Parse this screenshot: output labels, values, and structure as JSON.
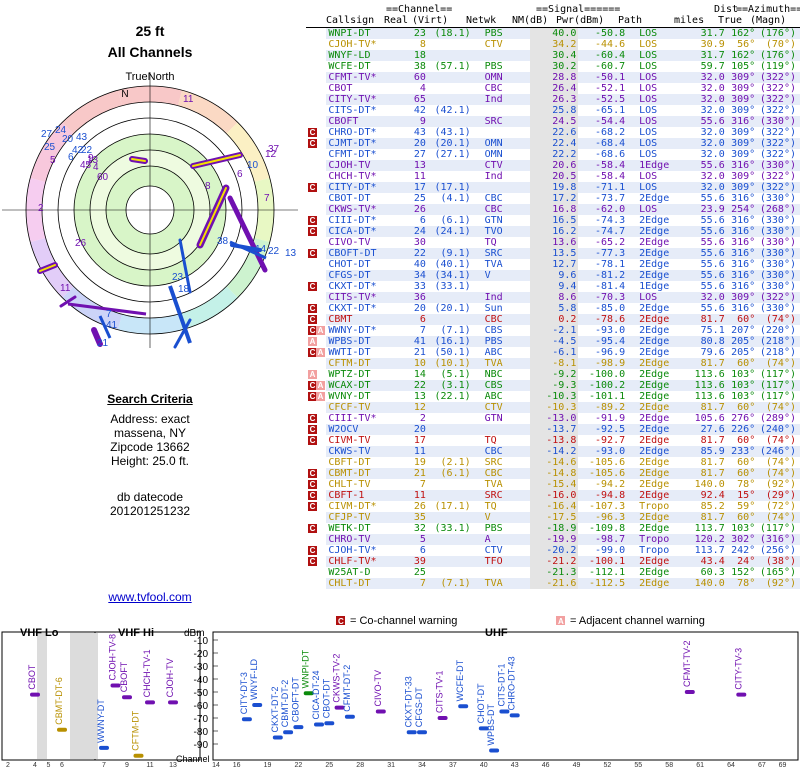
{
  "page": {
    "title": "25 ft",
    "subtitle": "All Channels"
  },
  "polar": {
    "north_label": "TrueNorth",
    "n_letter": "N"
  },
  "criteria": {
    "header": "Search Criteria",
    "address": "Address: exact",
    "city": "massena, NY",
    "zip": "Zipcode 13662",
    "height": "Height: 25.0 ft.",
    "db_label": "db datecode",
    "db_value": "201201251232"
  },
  "link": "www.tvfool.com",
  "table_header": {
    "group_channel": "==Channel==",
    "group_signal": "==Signal======",
    "group_dist": "Dist",
    "group_azimuth": "==Azimuth==",
    "callsign": "Callsign",
    "real": "Real",
    "virt": "(Virt)",
    "netwk": "Netwk",
    "nm": "NM(dB)",
    "pwr": "Pwr(dBm)",
    "path": "Path",
    "miles": "miles",
    "true": "True",
    "magn": "(Magn)"
  },
  "colors": {
    "green": "#0a8a0a",
    "blue": "#1a4fd0",
    "red": "#c01010",
    "yellow": "#b89000",
    "purple": "#7010b0",
    "pink": "#c040c0",
    "gray_bg": "#e4e4e4",
    "blue_bg": "#e6ecf8"
  },
  "stations": [
    {
      "cs": "WNPI-DT",
      "real": "23",
      "virt": "(18.1)",
      "net": "PBS",
      "nm": "40.0",
      "pwr": "-50.8",
      "path": "LOS",
      "miles": "31.7",
      "az": "162°",
      "mag": "(176°)",
      "c": "green",
      "warn": ""
    },
    {
      "cs": "CJOH-TV*",
      "real": "8",
      "virt": "",
      "net": "CTV",
      "nm": "34.2",
      "pwr": "-44.6",
      "path": "LOS",
      "miles": "30.9",
      "az": "56°",
      "mag": "(70°)",
      "c": "yellow",
      "warn": ""
    },
    {
      "cs": "WNYF-LD",
      "real": "18",
      "virt": "",
      "net": "",
      "nm": "30.4",
      "pwr": "-60.4",
      "path": "LOS",
      "miles": "31.7",
      "az": "162°",
      "mag": "(176°)",
      "c": "green",
      "warn": ""
    },
    {
      "cs": "WCFE-DT",
      "real": "38",
      "virt": "(57.1)",
      "net": "PBS",
      "nm": "30.2",
      "pwr": "-60.7",
      "path": "LOS",
      "miles": "59.7",
      "az": "105°",
      "mag": "(119°)",
      "c": "green",
      "warn": ""
    },
    {
      "cs": "CFMT-TV*",
      "real": "60",
      "virt": "",
      "net": "OMN",
      "nm": "28.8",
      "pwr": "-50.1",
      "path": "LOS",
      "miles": "32.0",
      "az": "309°",
      "mag": "(322°)",
      "c": "purple",
      "warn": ""
    },
    {
      "cs": "CBOT",
      "real": "4",
      "virt": "",
      "net": "CBC",
      "nm": "26.4",
      "pwr": "-52.1",
      "path": "LOS",
      "miles": "32.0",
      "az": "309°",
      "mag": "(322°)",
      "c": "purple",
      "warn": ""
    },
    {
      "cs": "CITY-TV*",
      "real": "65",
      "virt": "",
      "net": "Ind",
      "nm": "26.3",
      "pwr": "-52.5",
      "path": "LOS",
      "miles": "32.0",
      "az": "309°",
      "mag": "(322°)",
      "c": "purple",
      "warn": ""
    },
    {
      "cs": "CITS-DT*",
      "real": "42",
      "virt": "(42.1)",
      "net": "",
      "nm": "25.8",
      "pwr": "-65.1",
      "path": "LOS",
      "miles": "32.0",
      "az": "309°",
      "mag": "(322°)",
      "c": "blue",
      "warn": ""
    },
    {
      "cs": "CBOFT",
      "real": "9",
      "virt": "",
      "net": "SRC",
      "nm": "24.5",
      "pwr": "-54.4",
      "path": "LOS",
      "miles": "55.6",
      "az": "316°",
      "mag": "(330°)",
      "c": "purple",
      "warn": ""
    },
    {
      "cs": "CHRO-DT*",
      "real": "43",
      "virt": "(43.1)",
      "net": "",
      "nm": "22.6",
      "pwr": "-68.2",
      "path": "LOS",
      "miles": "32.0",
      "az": "309°",
      "mag": "(322°)",
      "c": "blue",
      "warn": "C"
    },
    {
      "cs": "CJMT-DT*",
      "real": "20",
      "virt": "(20.1)",
      "net": "OMN",
      "nm": "22.4",
      "pwr": "-68.4",
      "path": "LOS",
      "miles": "32.0",
      "az": "309°",
      "mag": "(322°)",
      "c": "blue",
      "warn": "C"
    },
    {
      "cs": "CFMT-DT*",
      "real": "27",
      "virt": "(27.1)",
      "net": "OMN",
      "nm": "22.2",
      "pwr": "-68.6",
      "path": "LOS",
      "miles": "32.0",
      "az": "309°",
      "mag": "(322°)",
      "c": "blue",
      "warn": ""
    },
    {
      "cs": "CJOH-TV",
      "real": "13",
      "virt": "",
      "net": "CTV",
      "nm": "20.6",
      "pwr": "-58.4",
      "path": "1Edge",
      "miles": "55.6",
      "az": "316°",
      "mag": "(330°)",
      "c": "purple",
      "warn": ""
    },
    {
      "cs": "CHCH-TV*",
      "real": "11",
      "virt": "",
      "net": "Ind",
      "nm": "20.5",
      "pwr": "-58.4",
      "path": "LOS",
      "miles": "32.0",
      "az": "309°",
      "mag": "(322°)",
      "c": "purple",
      "warn": ""
    },
    {
      "cs": "CITY-DT*",
      "real": "17",
      "virt": "(17.1)",
      "net": "",
      "nm": "19.8",
      "pwr": "-71.1",
      "path": "LOS",
      "miles": "32.0",
      "az": "309°",
      "mag": "(322°)",
      "c": "blue",
      "warn": "C"
    },
    {
      "cs": "CBOT-DT",
      "real": "25",
      "virt": "(4.1)",
      "net": "CBC",
      "nm": "17.2",
      "pwr": "-73.7",
      "path": "2Edge",
      "miles": "55.6",
      "az": "316°",
      "mag": "(330°)",
      "c": "blue",
      "warn": ""
    },
    {
      "cs": "CKWS-TV*",
      "real": "26",
      "virt": "",
      "net": "CBC",
      "nm": "16.8",
      "pwr": "-62.0",
      "path": "LOS",
      "miles": "23.9",
      "az": "254°",
      "mag": "(268°)",
      "c": "purple",
      "warn": ""
    },
    {
      "cs": "CIII-DT*",
      "real": "6",
      "virt": "(6.1)",
      "net": "GTN",
      "nm": "16.5",
      "pwr": "-74.3",
      "path": "2Edge",
      "miles": "55.6",
      "az": "316°",
      "mag": "(330°)",
      "c": "blue",
      "warn": "C"
    },
    {
      "cs": "CICA-DT*",
      "real": "24",
      "virt": "(24.1)",
      "net": "TVO",
      "nm": "16.2",
      "pwr": "-74.7",
      "path": "2Edge",
      "miles": "55.6",
      "az": "316°",
      "mag": "(330°)",
      "c": "blue",
      "warn": "C"
    },
    {
      "cs": "CIVO-TV",
      "real": "30",
      "virt": "",
      "net": "TQ",
      "nm": "13.6",
      "pwr": "-65.2",
      "path": "2Edge",
      "miles": "55.6",
      "az": "316°",
      "mag": "(330°)",
      "c": "purple",
      "warn": ""
    },
    {
      "cs": "CBOFT-DT",
      "real": "22",
      "virt": "(9.1)",
      "net": "SRC",
      "nm": "13.5",
      "pwr": "-77.3",
      "path": "2Edge",
      "miles": "55.6",
      "az": "316°",
      "mag": "(330°)",
      "c": "blue",
      "warn": "C"
    },
    {
      "cs": "CHOT-DT",
      "real": "40",
      "virt": "(40.1)",
      "net": "TVA",
      "nm": "12.7",
      "pwr": "-78.1",
      "path": "2Edge",
      "miles": "55.6",
      "az": "316°",
      "mag": "(330°)",
      "c": "blue",
      "warn": ""
    },
    {
      "cs": "CFGS-DT",
      "real": "34",
      "virt": "(34.1)",
      "net": "V",
      "nm": "9.6",
      "pwr": "-81.2",
      "path": "2Edge",
      "miles": "55.6",
      "az": "316°",
      "mag": "(330°)",
      "c": "blue",
      "warn": ""
    },
    {
      "cs": "CKXT-DT*",
      "real": "33",
      "virt": "(33.1)",
      "net": "",
      "nm": "9.4",
      "pwr": "-81.4",
      "path": "1Edge",
      "miles": "55.6",
      "az": "316°",
      "mag": "(330°)",
      "c": "blue",
      "warn": "C"
    },
    {
      "cs": "CITS-TV*",
      "real": "36",
      "virt": "",
      "net": "Ind",
      "nm": "8.6",
      "pwr": "-70.3",
      "path": "LOS",
      "miles": "32.0",
      "az": "309°",
      "mag": "(322°)",
      "c": "purple",
      "warn": ""
    },
    {
      "cs": "CKXT-DT*",
      "real": "20",
      "virt": "(20.1)",
      "net": "Sun",
      "nm": "5.8",
      "pwr": "-85.0",
      "path": "2Edge",
      "miles": "55.6",
      "az": "316°",
      "mag": "(330°)",
      "c": "blue",
      "warn": "C"
    },
    {
      "cs": "CBMT",
      "real": "6",
      "virt": "",
      "net": "CBC",
      "nm": "0.2",
      "pwr": "-78.6",
      "path": "2Edge",
      "miles": "81.7",
      "az": "60°",
      "mag": "(74°)",
      "c": "red",
      "warn": "C"
    },
    {
      "cs": "WWNY-DT*",
      "real": "7",
      "virt": "(7.1)",
      "net": "CBS",
      "nm": "-2.1",
      "pwr": "-93.0",
      "path": "2Edge",
      "miles": "75.1",
      "az": "207°",
      "mag": "(220°)",
      "c": "blue",
      "warn": "CA"
    },
    {
      "cs": "WPBS-DT",
      "real": "41",
      "virt": "(16.1)",
      "net": "PBS",
      "nm": "-4.5",
      "pwr": "-95.4",
      "path": "2Edge",
      "miles": "80.8",
      "az": "205°",
      "mag": "(218°)",
      "c": "blue",
      "warn": "A"
    },
    {
      "cs": "WWTI-DT",
      "real": "21",
      "virt": "(50.1)",
      "net": "ABC",
      "nm": "-6.1",
      "pwr": "-96.9",
      "path": "2Edge",
      "miles": "79.6",
      "az": "205°",
      "mag": "(218°)",
      "c": "blue",
      "warn": "CA"
    },
    {
      "cs": "CFTM-DT",
      "real": "10",
      "virt": "(10.1)",
      "net": "TVA",
      "nm": "-8.1",
      "pwr": "-98.9",
      "path": "2Edge",
      "miles": "81.7",
      "az": "60°",
      "mag": "(74°)",
      "c": "yellow",
      "warn": ""
    },
    {
      "cs": "WPTZ-DT",
      "real": "14",
      "virt": "(5.1)",
      "net": "NBC",
      "nm": "-9.2",
      "pwr": "-100.0",
      "path": "2Edge",
      "miles": "113.6",
      "az": "103°",
      "mag": "(117°)",
      "c": "green",
      "warn": "A"
    },
    {
      "cs": "WCAX-DT",
      "real": "22",
      "virt": "(3.1)",
      "net": "CBS",
      "nm": "-9.3",
      "pwr": "-100.2",
      "path": "2Edge",
      "miles": "113.6",
      "az": "103°",
      "mag": "(117°)",
      "c": "green",
      "warn": "CA"
    },
    {
      "cs": "WVNY-DT",
      "real": "13",
      "virt": "(22.1)",
      "net": "ABC",
      "nm": "-10.3",
      "pwr": "-101.1",
      "path": "2Edge",
      "miles": "113.6",
      "az": "103°",
      "mag": "(117°)",
      "c": "green",
      "warn": "CA"
    },
    {
      "cs": "CFCF-TV",
      "real": "12",
      "virt": "",
      "net": "CTV",
      "nm": "-10.3",
      "pwr": "-89.2",
      "path": "2Edge",
      "miles": "81.7",
      "az": "60°",
      "mag": "(74°)",
      "c": "yellow",
      "warn": ""
    },
    {
      "cs": "CIII-TV*",
      "real": "2",
      "virt": "",
      "net": "GTN",
      "nm": "-13.0",
      "pwr": "-91.9",
      "path": "2Edge",
      "miles": "105.6",
      "az": "276°",
      "mag": "(289°)",
      "c": "purple",
      "warn": "C"
    },
    {
      "cs": "W2OCV",
      "real": "20",
      "virt": "",
      "net": "",
      "nm": "-13.7",
      "pwr": "-92.5",
      "path": "2Edge",
      "miles": "27.6",
      "az": "226°",
      "mag": "(240°)",
      "c": "blue",
      "warn": "C"
    },
    {
      "cs": "CIVM-TV",
      "real": "17",
      "virt": "",
      "net": "TQ",
      "nm": "-13.8",
      "pwr": "-92.7",
      "path": "2Edge",
      "miles": "81.7",
      "az": "60°",
      "mag": "(74°)",
      "c": "red",
      "warn": "C"
    },
    {
      "cs": "CKWS-TV",
      "real": "11",
      "virt": "",
      "net": "CBC",
      "nm": "-14.2",
      "pwr": "-93.0",
      "path": "2Edge",
      "miles": "85.9",
      "az": "233°",
      "mag": "(246°)",
      "c": "blue",
      "warn": ""
    },
    {
      "cs": "CBFT-DT",
      "real": "19",
      "virt": "(2.1)",
      "net": "SRC",
      "nm": "-14.6",
      "pwr": "-105.6",
      "path": "2Edge",
      "miles": "81.7",
      "az": "60°",
      "mag": "(74°)",
      "c": "yellow",
      "warn": ""
    },
    {
      "cs": "CBMT-DT",
      "real": "21",
      "virt": "(6.1)",
      "net": "CBC",
      "nm": "-14.8",
      "pwr": "-105.6",
      "path": "2Edge",
      "miles": "81.7",
      "az": "60°",
      "mag": "(74°)",
      "c": "yellow",
      "warn": "C"
    },
    {
      "cs": "CHLT-TV",
      "real": "7",
      "virt": "",
      "net": "TVA",
      "nm": "-15.4",
      "pwr": "-94.2",
      "path": "2Edge",
      "miles": "140.0",
      "az": "78°",
      "mag": "(92°)",
      "c": "yellow",
      "warn": "C"
    },
    {
      "cs": "CBFT-1",
      "real": "11",
      "virt": "",
      "net": "SRC",
      "nm": "-16.0",
      "pwr": "-94.8",
      "path": "2Edge",
      "miles": "92.4",
      "az": "15°",
      "mag": "(29°)",
      "c": "red",
      "warn": "C"
    },
    {
      "cs": "CIVM-DT*",
      "real": "26",
      "virt": "(17.1)",
      "net": "TQ",
      "nm": "-16.4",
      "pwr": "-107.3",
      "path": "Tropo",
      "miles": "85.2",
      "az": "59°",
      "mag": "(72°)",
      "c": "yellow",
      "warn": "C"
    },
    {
      "cs": "CFJP-TV",
      "real": "35",
      "virt": "",
      "net": "V",
      "nm": "-17.5",
      "pwr": "-96.3",
      "path": "2Edge",
      "miles": "81.7",
      "az": "60°",
      "mag": "(74°)",
      "c": "yellow",
      "warn": ""
    },
    {
      "cs": "WETK-DT",
      "real": "32",
      "virt": "(33.1)",
      "net": "PBS",
      "nm": "-18.9",
      "pwr": "-109.8",
      "path": "2Edge",
      "miles": "113.7",
      "az": "103°",
      "mag": "(117°)",
      "c": "green",
      "warn": "C"
    },
    {
      "cs": "CHRO-TV",
      "real": "5",
      "virt": "",
      "net": "A",
      "nm": "-19.9",
      "pwr": "-98.7",
      "path": "Tropo",
      "miles": "120.2",
      "az": "302°",
      "mag": "(316°)",
      "c": "purple",
      "warn": ""
    },
    {
      "cs": "CJOH-TV*",
      "real": "6",
      "virt": "",
      "net": "CTV",
      "nm": "-20.2",
      "pwr": "-99.0",
      "path": "Tropo",
      "miles": "113.7",
      "az": "242°",
      "mag": "(256°)",
      "c": "blue",
      "warn": "C"
    },
    {
      "cs": "CHLF-TV*",
      "real": "39",
      "virt": "",
      "net": "TFO",
      "nm": "-21.2",
      "pwr": "-100.1",
      "path": "2Edge",
      "miles": "43.4",
      "az": "24°",
      "mag": "(38°)",
      "c": "red",
      "warn": "C"
    },
    {
      "cs": "W25AT-D",
      "real": "25",
      "virt": "",
      "net": "",
      "nm": "-21.3",
      "pwr": "-112.1",
      "path": "2Edge",
      "miles": "60.3",
      "az": "152°",
      "mag": "(165°)",
      "c": "green",
      "warn": ""
    },
    {
      "cs": "CHLT-DT",
      "real": "7",
      "virt": "(7.1)",
      "net": "TVA",
      "nm": "-21.6",
      "pwr": "-112.5",
      "path": "2Edge",
      "miles": "140.0",
      "az": "78°",
      "mag": "(92°)",
      "c": "yellow",
      "warn": ""
    }
  ],
  "polar_labels": [
    {
      "t": "11",
      "c": "purple"
    },
    {
      "t": "27",
      "c": "blue"
    },
    {
      "t": "24",
      "c": "blue"
    },
    {
      "t": "20",
      "c": "blue"
    },
    {
      "t": "25",
      "c": "blue"
    },
    {
      "t": "43",
      "c": "blue"
    },
    {
      "t": "42",
      "c": "blue"
    },
    {
      "t": "22",
      "c": "blue"
    },
    {
      "t": "6",
      "c": "blue"
    },
    {
      "t": "9",
      "c": "purple"
    },
    {
      "t": "5",
      "c": "purple"
    },
    {
      "t": "13",
      "c": "purple"
    },
    {
      "t": "45",
      "c": "purple"
    },
    {
      "t": "4",
      "c": "purple"
    },
    {
      "t": "60",
      "c": "purple"
    },
    {
      "t": "2",
      "c": "purple"
    },
    {
      "t": "26",
      "c": "purple"
    },
    {
      "t": "8",
      "c": "purple"
    },
    {
      "t": "6",
      "c": "purple"
    },
    {
      "t": "10",
      "c": "blue"
    },
    {
      "t": "12",
      "c": "purple"
    },
    {
      "t": "37",
      "c": "purple"
    },
    {
      "t": "7",
      "c": "purple"
    },
    {
      "t": "38",
      "c": "blue"
    },
    {
      "t": "14",
      "c": "blue"
    },
    {
      "t": "22",
      "c": "blue"
    },
    {
      "t": "13",
      "c": "blue"
    },
    {
      "t": "23",
      "c": "blue"
    },
    {
      "t": "18",
      "c": "blue"
    },
    {
      "t": "11",
      "c": "purple"
    },
    {
      "t": "7",
      "c": "blue"
    },
    {
      "t": "41",
      "c": "blue"
    },
    {
      "t": "21",
      "c": "blue"
    }
  ],
  "bottom": {
    "legend_co": "= Co-channel warning",
    "legend_adj": "= Adjacent channel warning",
    "legend_co_badge": "C",
    "legend_adj_badge": "A",
    "vhf_lo": "VHF Lo",
    "vhf_hi": "VHF Hi",
    "uhf": "UHF",
    "dbm_label": "dBm",
    "channel_label": "Channel",
    "y_ticks": [
      "-10",
      "-20",
      "-30",
      "-40",
      "-50",
      "-60",
      "-70",
      "-80",
      "-90"
    ],
    "vhflo_ch": [
      "2",
      "4",
      "5",
      "6"
    ],
    "vhfhi_ch": [
      "7",
      "9",
      "11",
      "13"
    ],
    "uhf_ch": [
      "14",
      "16",
      "19",
      "22",
      "25",
      "28",
      "31",
      "34",
      "37",
      "40",
      "43",
      "46",
      "49",
      "52",
      "55",
      "58",
      "61",
      "64",
      "67",
      "69"
    ],
    "bars": [
      {
        "name": "CBOT",
        "ch": 4,
        "dbm": -52,
        "c": "purple"
      },
      {
        "name": "CBMT-DT-6",
        "ch": 6,
        "dbm": -79,
        "c": "yellow"
      },
      {
        "name": "WWNY-DT",
        "ch": 7,
        "dbm": -93,
        "c": "blue"
      },
      {
        "name": "CJOH-TV-8",
        "ch": 8,
        "dbm": -45,
        "c": "purple"
      },
      {
        "name": "CBOFT",
        "ch": 9,
        "dbm": -54,
        "c": "purple"
      },
      {
        "name": "CFTM-DT",
        "ch": 10,
        "dbm": -99,
        "c": "yellow"
      },
      {
        "name": "CHCH-TV-1",
        "ch": 11,
        "dbm": -58,
        "c": "purple"
      },
      {
        "name": "CJOH-TV",
        "ch": 13,
        "dbm": -58,
        "c": "purple"
      },
      {
        "name": "CITY-DT-3",
        "ch": 17,
        "dbm": -71,
        "c": "blue"
      },
      {
        "name": "WNYF-LD",
        "ch": 18,
        "dbm": -60,
        "c": "blue"
      },
      {
        "name": "CKXT-DT-2",
        "ch": 20,
        "dbm": -85,
        "c": "blue"
      },
      {
        "name": "CBMT-DT-2",
        "ch": 21,
        "dbm": -81,
        "c": "blue"
      },
      {
        "name": "CBOFT-DT",
        "ch": 22,
        "dbm": -77,
        "c": "blue"
      },
      {
        "name": "WNPI-DT",
        "ch": 23,
        "dbm": -51,
        "c": "green"
      },
      {
        "name": "CICA-DT-24",
        "ch": 24,
        "dbm": -75,
        "c": "blue"
      },
      {
        "name": "CBOT-DT",
        "ch": 25,
        "dbm": -74,
        "c": "blue"
      },
      {
        "name": "CKWS-TV-2",
        "ch": 26,
        "dbm": -62,
        "c": "purple"
      },
      {
        "name": "CFMT-DT-2",
        "ch": 27,
        "dbm": -69,
        "c": "blue"
      },
      {
        "name": "CIVO-TV",
        "ch": 30,
        "dbm": -65,
        "c": "purple"
      },
      {
        "name": "CITS-TV-1",
        "ch": 36,
        "dbm": -70,
        "c": "purple"
      },
      {
        "name": "CKXT-DT-33",
        "ch": 33,
        "dbm": -81,
        "c": "blue"
      },
      {
        "name": "CFGS-DT",
        "ch": 34,
        "dbm": -81,
        "c": "blue"
      },
      {
        "name": "WCFE-DT",
        "ch": 38,
        "dbm": -61,
        "c": "blue"
      },
      {
        "name": "CHOT-DT",
        "ch": 40,
        "dbm": -78,
        "c": "blue"
      },
      {
        "name": "WPBS-DT",
        "ch": 41,
        "dbm": -95,
        "c": "blue"
      },
      {
        "name": "CITS-DT-1",
        "ch": 42,
        "dbm": -65,
        "c": "blue"
      },
      {
        "name": "CHRO-DT-43",
        "ch": 43,
        "dbm": -68,
        "c": "blue"
      },
      {
        "name": "CFMT-TV-2",
        "ch": 60,
        "dbm": -50,
        "c": "purple"
      },
      {
        "name": "CITY-TV-3",
        "ch": 65,
        "dbm": -52,
        "c": "purple"
      }
    ]
  }
}
